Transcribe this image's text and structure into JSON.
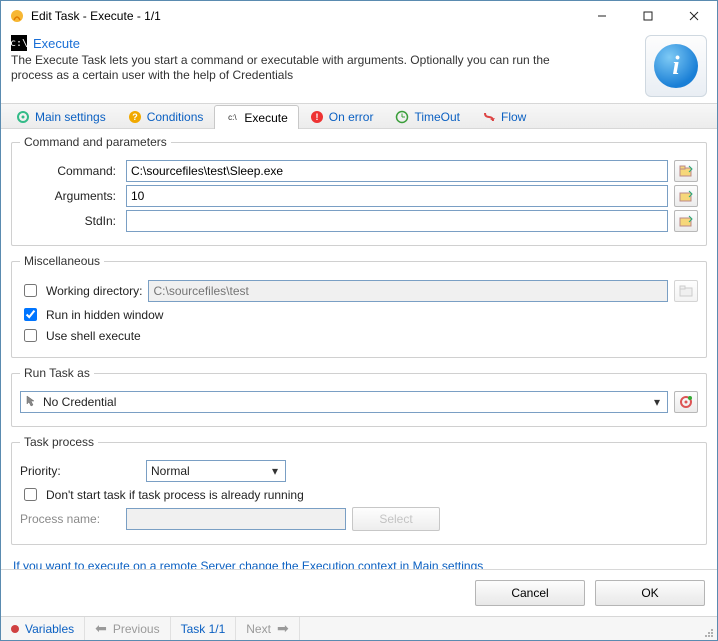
{
  "window": {
    "title": "Edit Task - Execute - 1/1"
  },
  "header": {
    "title": "Execute",
    "desc": "The Execute Task lets you start a command or executable with arguments. Optionally you can run the process as a certain user with the help of Credentials"
  },
  "tabs": {
    "main": "Main settings",
    "conditions": "Conditions",
    "execute": "Execute",
    "onerror": "On error",
    "timeout": "TimeOut",
    "flow": "Flow"
  },
  "cmdparams": {
    "legend": "Command and parameters",
    "command_label": "Command:",
    "command_value": "C:\\sourcefiles\\test\\Sleep.exe",
    "arguments_label": "Arguments:",
    "arguments_value": "10",
    "stdin_label": "StdIn:",
    "stdin_value": ""
  },
  "misc": {
    "legend": "Miscellaneous",
    "workdir_label": "Working directory:",
    "workdir_placeholder": "C:\\sourcefiles\\test",
    "workdir_checked": false,
    "hidden_label": "Run in hidden window",
    "hidden_checked": true,
    "shell_label": "Use shell execute",
    "shell_checked": false
  },
  "runas": {
    "legend": "Run Task as",
    "value": "No Credential"
  },
  "process": {
    "legend": "Task process",
    "priority_label": "Priority:",
    "priority_value": "Normal",
    "dontstart_label": "Don't start task if task process is already running",
    "dontstart_checked": false,
    "procname_label": "Process name:",
    "procname_value": "",
    "select_btn": "Select"
  },
  "link": "If you want to execute on a remote Server change the Execution context in Main settings",
  "buttons": {
    "cancel": "Cancel",
    "ok": "OK"
  },
  "status": {
    "variables": "Variables",
    "previous": "Previous",
    "task": "Task 1/1",
    "next": "Next"
  }
}
